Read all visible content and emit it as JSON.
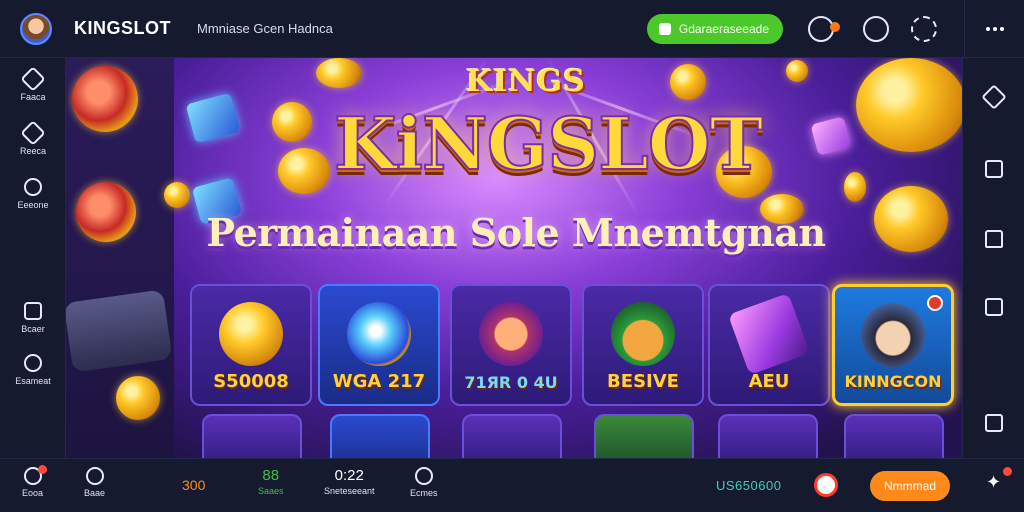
{
  "header": {
    "brand": "KINGSLOT",
    "subtitle": "Mmniase Gcen Hadnca",
    "green_button": "Gdaraeraseeade"
  },
  "left_nav": [
    {
      "label": "Faaca",
      "icon": "home-icon"
    },
    {
      "label": "Reeca",
      "icon": "games-icon"
    },
    {
      "label": "Eeeone",
      "icon": "promo-icon"
    },
    {
      "label": "Bcaer",
      "icon": "wallet-icon"
    },
    {
      "label": "Esameat",
      "icon": "info-icon"
    }
  ],
  "hero": {
    "kings_small": "KINGS",
    "title": "KiNGSLOT",
    "tagline": "Permainaan Sole Mnemtgnan",
    "cards": [
      {
        "label": "S50008",
        "icon": "gold-coin-icon"
      },
      {
        "label": "WGA 217",
        "icon": "orb-icon"
      },
      {
        "label": "71ЯR 0 4U",
        "icon": "cat-mascot-icon"
      },
      {
        "label": "BESIVE",
        "icon": "fox-mascot-icon"
      },
      {
        "label": "AEU",
        "icon": "crystal-bar-icon"
      },
      {
        "label": "KINNGCON",
        "icon": "hero-character-icon"
      }
    ]
  },
  "bottom_nav": [
    {
      "label": "Eooa",
      "icon": "rocket-icon"
    },
    {
      "label": "Baae",
      "icon": "chat-icon"
    },
    {
      "value": "300",
      "color": "#ff8c1a"
    },
    {
      "value": "88",
      "label": "Saaes",
      "color": "#3ac04a"
    },
    {
      "value": "0:22",
      "label": "Sneteseeant"
    },
    {
      "label": "Ecmes",
      "icon": "timer-icon"
    }
  ],
  "bottom_right": {
    "balance": "US650600",
    "action_button": "Nmmmad"
  },
  "colors": {
    "accent_green": "#4cc92a",
    "accent_orange": "#ff8a1a",
    "balance_teal": "#3ad0c0"
  }
}
